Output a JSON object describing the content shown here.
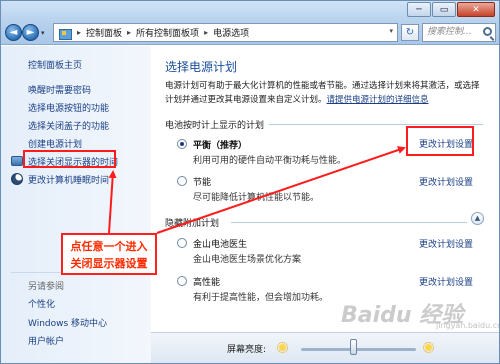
{
  "window": {
    "controls": {
      "minimize": "─",
      "maximize": "▭",
      "close": "✕"
    }
  },
  "nav": {
    "back": "◄",
    "forward": "►",
    "dropdown": "▾"
  },
  "address": {
    "breadcrumbs": [
      "控制面板",
      "所有控制面板项",
      "电源选项"
    ],
    "separator": "▸",
    "dropdown": "▾"
  },
  "refresh_glyph": "↻",
  "search": {
    "placeholder": "搜索控制..."
  },
  "sidebar": {
    "home": "控制面板主页",
    "items": [
      "唤醒时需要密码",
      "选择电源按钮的功能",
      "选择关闭盖子的功能",
      "创建电源计划",
      "选择关闭显示器的时间",
      "更改计算机睡眠时间"
    ],
    "see_also_title": "另请参阅",
    "see_also": [
      "个性化",
      "Windows 移动中心",
      "用户帐户"
    ]
  },
  "callout": {
    "line1": "点任意一个进入",
    "line2": "关闭显示器设置"
  },
  "main": {
    "title": "选择电源计划",
    "description": "电源计划可有助于最大化计算机的性能或者节能。通过选择计划来将其激活，或选择计划并通过更改其电源设置来自定义计划。",
    "description_link": "请提供电源计划的详细信息",
    "battery_group": "电池按时计上显示的计划",
    "plans": [
      {
        "name": "平衡（推荐）",
        "desc": "利用可用的硬件自动平衡功耗与性能。",
        "selected": true,
        "link": "更改计划设置"
      },
      {
        "name": "节能",
        "desc": "尽可能降低计算机性能以节能。",
        "selected": false,
        "link": "更改计划设置"
      }
    ],
    "hidden_group": "隐藏附加计划",
    "hidden_plans": [
      {
        "name": "金山电池医生",
        "desc": "金山电池医生场景优化方案",
        "selected": false,
        "link": "更改计划设置"
      },
      {
        "name": "高性能",
        "desc": "有利于提高性能，但会增加功耗。",
        "selected": false,
        "link": "更改计划设置"
      }
    ],
    "collapse_glyph": "▲"
  },
  "brightness": {
    "label": "屏幕亮度:",
    "level": 0.45
  },
  "watermark": {
    "text": "Baidu 经验",
    "sub": "jingyan.baidu.com"
  },
  "colors": {
    "annotation_red": "#ff1c1c",
    "link_blue": "#1a3f86",
    "title_blue": "#1a4e9c"
  }
}
